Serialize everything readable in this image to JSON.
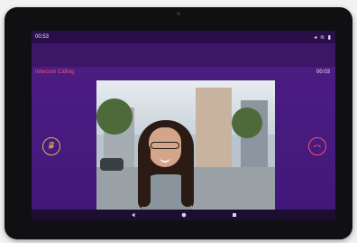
{
  "status_bar": {
    "time": "00:53",
    "system_icons": "◂ ≋ ▮"
  },
  "call": {
    "title": "Intercom Calling",
    "timer": "00:03"
  },
  "icons": {
    "mute": "microphone-off-icon",
    "end_call": "phone-hangup-icon",
    "back": "back-icon",
    "home": "home-icon",
    "recents": "recents-icon"
  },
  "colors": {
    "accent_red": "#ff4d6a",
    "accent_gold": "#e0b54a",
    "background_purple": "#4b1d83"
  }
}
